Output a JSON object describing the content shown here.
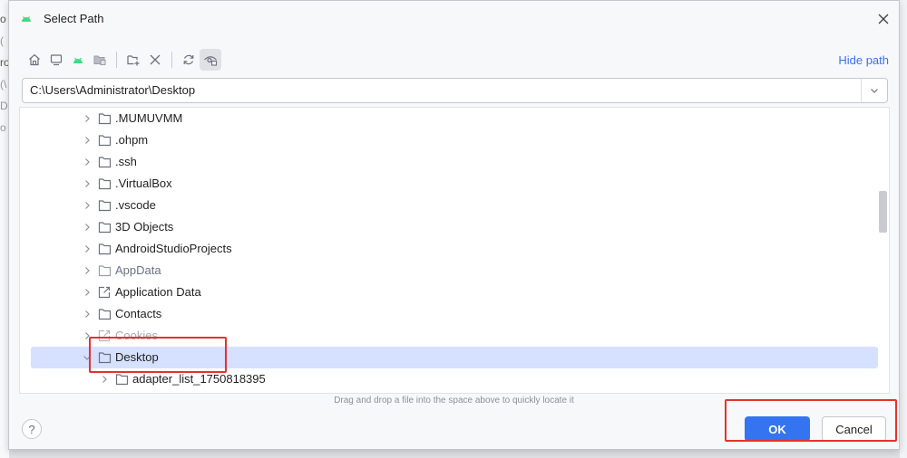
{
  "background_fragments": [
    "o",
    "(",
    "ro",
    "(\\",
    "D",
    "o"
  ],
  "dialog": {
    "title": "Select Path",
    "hide_path_label": "Hide path",
    "toolbar_icons": [
      "home-icon",
      "desktop-icon",
      "android-project-icon",
      "module-folder-icon",
      "new-folder-icon",
      "delete-icon",
      "refresh-icon",
      "show-hidden-icon"
    ],
    "path_value": "C:\\Users\\Administrator\\Desktop",
    "tree": [
      {
        "label": ".MUMUVMM",
        "level": 1,
        "icon": "folder",
        "state": "normal"
      },
      {
        "label": ".ohpm",
        "level": 1,
        "icon": "folder",
        "state": "normal"
      },
      {
        "label": ".ssh",
        "level": 1,
        "icon": "folder",
        "state": "normal"
      },
      {
        "label": ".VirtualBox",
        "level": 1,
        "icon": "folder",
        "state": "normal"
      },
      {
        "label": ".vscode",
        "level": 1,
        "icon": "folder",
        "state": "normal"
      },
      {
        "label": "3D Objects",
        "level": 1,
        "icon": "folder",
        "state": "normal"
      },
      {
        "label": "AndroidStudioProjects",
        "level": 1,
        "icon": "folder",
        "state": "normal"
      },
      {
        "label": "AppData",
        "level": 1,
        "icon": "folder",
        "state": "dim"
      },
      {
        "label": "Application Data",
        "level": 1,
        "icon": "link",
        "state": "normal"
      },
      {
        "label": "Contacts",
        "level": 1,
        "icon": "folder",
        "state": "normal"
      },
      {
        "label": "Cookies",
        "level": 1,
        "icon": "link",
        "state": "faded"
      },
      {
        "label": "Desktop",
        "level": 1,
        "icon": "folder",
        "state": "selected",
        "expanded": true
      },
      {
        "label": "adapter_list_1750818395",
        "level": 2,
        "icon": "folder",
        "state": "normal"
      }
    ],
    "hint": "Drag and drop a file into the space above to quickly locate it",
    "help_label": "?",
    "ok_label": "OK",
    "cancel_label": "Cancel"
  },
  "colors": {
    "accent": "#3574f0",
    "selection": "#d5e1ff",
    "annotation": "#e5322d",
    "android_green": "#3ddc84"
  }
}
